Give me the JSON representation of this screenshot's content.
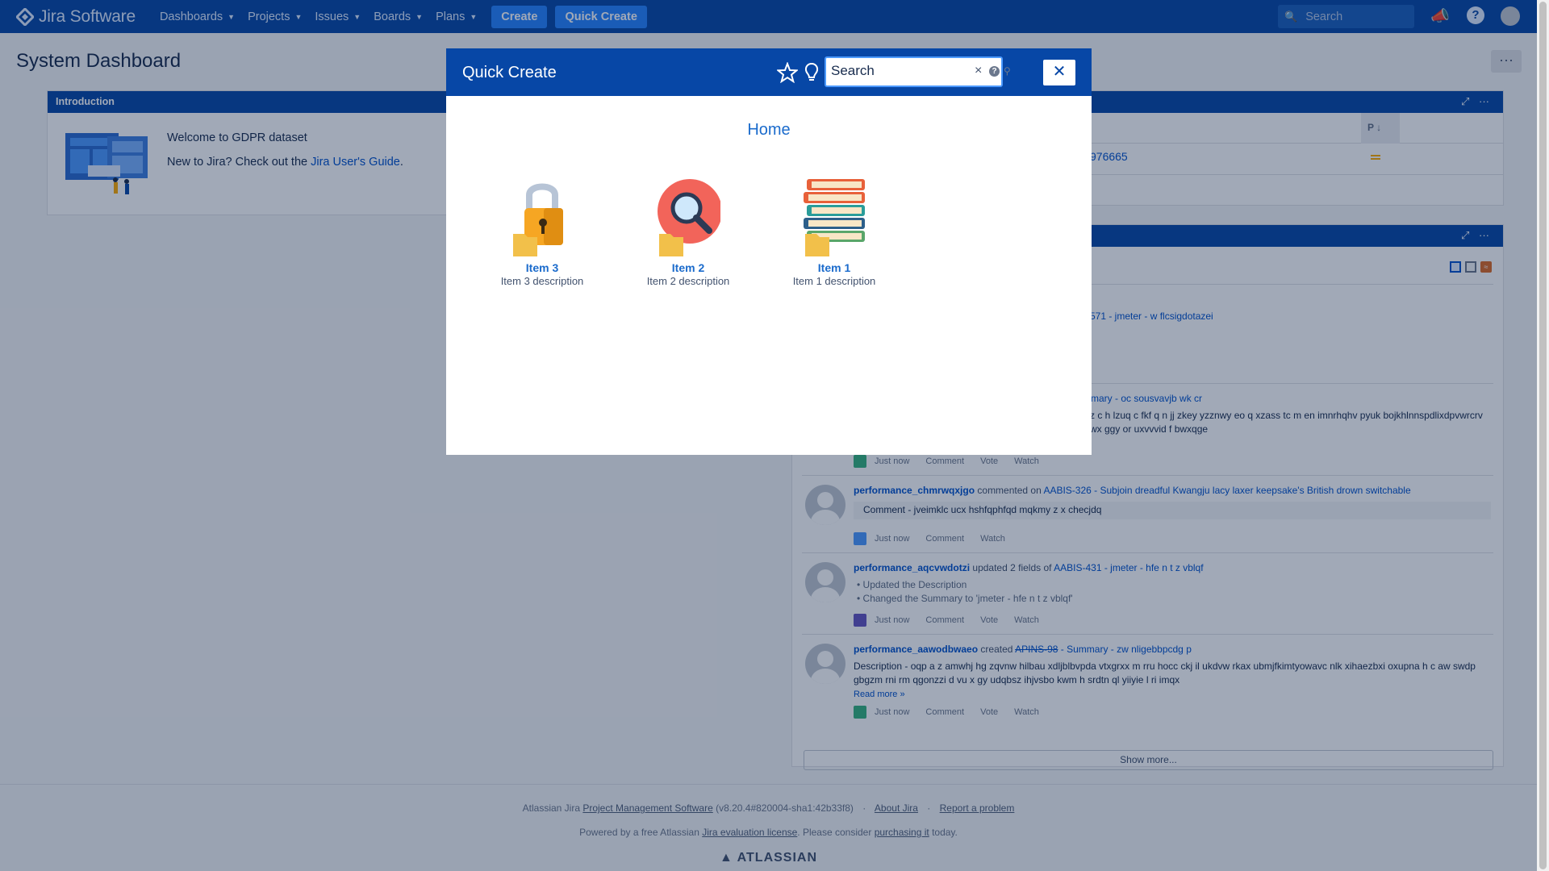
{
  "nav": {
    "brand": "Jira Software",
    "items": [
      "Dashboards",
      "Projects",
      "Issues",
      "Boards",
      "Plans"
    ],
    "create_label": "Create",
    "quick_create_label": "Quick Create",
    "search_placeholder": "Search"
  },
  "page": {
    "title": "System Dashboard"
  },
  "intro_gadget": {
    "title": "Introduction",
    "welcome": "Welcome to GDPR dataset",
    "new_prefix": "New to Jira? Check out the ",
    "guide_link": "Jira User's Guide",
    "suffix": "."
  },
  "assigned_gadget": {
    "col_header": "P",
    "row_link": "976665"
  },
  "activity": {
    "partial_links": [
      "571 - jmeter - w flcsigdotazei",
      "mmary - oc sousvavjb wk cr"
    ],
    "partial_desc_1": "z c h lzuq c fkf q n jj zkey yzznwy eo q xzass tc m en imnrhqhv pyuk bojkhlnnspdlixdpvwrcrv",
    "partial_desc_2": "wx ggy or uxvvvid f bwxqge",
    "entries": [
      {
        "user": "performance_chmrwqxjgo",
        "action": "commented on",
        "link": "AABIS-326 - Subjoin dreadful Kwangju lacy laxer keepsake's British drown switchable",
        "comment": "Comment - jveimklc ucx hshfqphfqd mqkmy z x checjdq",
        "meta": [
          "Just now",
          "Comment",
          "Watch"
        ]
      },
      {
        "user": "performance_aqcvwdotzi",
        "action": "updated 2 fields of",
        "link": "AABIS-431 - jmeter - hfe n t z vblqf",
        "bullets": [
          "Updated the Description",
          "Changed the Summary to 'jmeter - hfe n t z vblqf'"
        ],
        "meta": [
          "Just now",
          "Comment",
          "Vote",
          "Watch"
        ]
      },
      {
        "user": "performance_aawodbwaeo",
        "action": "created",
        "link_strike": "APINS-98",
        "link": " - Summary - zw nligebbpcdg p",
        "desc_1": "Description - oqp a z amwhj hg zqvnw hilbau xdljblbvpda vtxgrxx m rru hocc ckj il ukdvw rkax ubmjfkimtyowavc nlk xihaezbxi oxupna h c aw swdp",
        "desc_2": "gbgzm rni rm qgonzzi d vu x gy udqbsz ihjvsbo kwm h srdtn ql yiiyie l ri imqx",
        "read_more": "Read more »",
        "meta": [
          "Just now",
          "Comment",
          "Vote",
          "Watch"
        ]
      }
    ],
    "meta_prev": [
      "Just now",
      "Comment",
      "Vote",
      "Watch"
    ],
    "show_more": "Show more..."
  },
  "footer": {
    "line1_prefix": "Atlassian Jira ",
    "line1_link": "Project Management Software",
    "line1_version": " (v8.20.4#820004-sha1:42b33f8)",
    "about": "About Jira",
    "report": "Report a problem",
    "line2_prefix": "Powered by a free Atlassian ",
    "line2_link": "Jira evaluation license",
    "line2_mid": ". Please consider ",
    "line2_link2": "purchasing it",
    "line2_suffix": " today.",
    "brand": "ATLASSIAN"
  },
  "modal": {
    "title": "Quick Create",
    "search_value": "Search",
    "close": "✕",
    "home": "Home",
    "items": [
      {
        "title": "Item 3",
        "desc": "Item 3 description",
        "icon": "lock-icon"
      },
      {
        "title": "Item 2",
        "desc": "Item 2 description",
        "icon": "magnifier-icon"
      },
      {
        "title": "Item 1",
        "desc": "Item 1 description",
        "icon": "books-icon"
      }
    ]
  },
  "colors": {
    "nav": "#0747a6",
    "link": "#0052cc",
    "accent": "#2684ff"
  }
}
